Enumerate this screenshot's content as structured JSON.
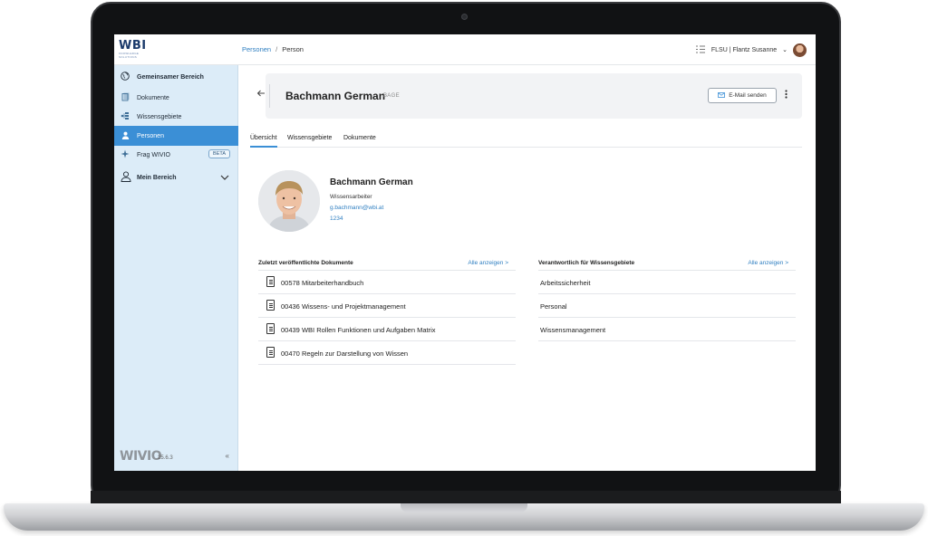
{
  "topbar": {
    "logo_text": "WBI",
    "logo_subtitle": "KNOWLEDGE SOLUTIONS",
    "breadcrumb": {
      "parent": "Personen",
      "separator": "/",
      "current": "Person"
    },
    "user_label": "FLSU | Flantz Susanne",
    "user_menu_caret": "⌄"
  },
  "sidebar": {
    "items": [
      {
        "label": "Gemeinsamer Bereich",
        "icon": "globe-icon"
      },
      {
        "label": "Dokumente",
        "icon": "documents-icon"
      },
      {
        "label": "Wissensgebiete",
        "icon": "knowledge-areas-icon"
      },
      {
        "label": "Personen",
        "icon": "person-icon",
        "active": true
      },
      {
        "label": "Frag WIVIO",
        "icon": "sparkle-icon",
        "badge": "BETA"
      },
      {
        "label": "Mein Bereich",
        "icon": "user-outline-icon"
      }
    ],
    "footer": {
      "brand": "WIVIO",
      "version": "25.6.3",
      "collapse": "«"
    }
  },
  "person_header": {
    "name": "Bachmann German",
    "code": "BAGE",
    "email_button": "E-Mail senden"
  },
  "tabs": [
    "Übersicht",
    "Wissensgebiete",
    "Dokumente"
  ],
  "profile": {
    "name": "Bachmann German",
    "role": "Wissensarbeiter",
    "email": "g.bachmann@wbi.at",
    "phone": "1234"
  },
  "documents_panel": {
    "title": "Zuletzt veröffentlichte Dokumente",
    "link": "Alle anzeigen >",
    "items": [
      "00578  Mitarbeiterhandbuch",
      "00436  Wissens- und Projektmanagement",
      "00439  WBI Rollen Funktionen und Aufgaben Matrix",
      "00470  Regeln zur Darstellung von Wissen"
    ]
  },
  "areas_panel": {
    "title": "Verantwortlich für Wissensgebiete",
    "link": "Alle anzeigen >",
    "items": [
      "Arbeitssicherheit",
      "Personal",
      "Wissensmanagement"
    ]
  },
  "colors": {
    "accent": "#3b8fd6",
    "sidebar_bg": "#dcecf8",
    "link": "#2f7fc1"
  }
}
